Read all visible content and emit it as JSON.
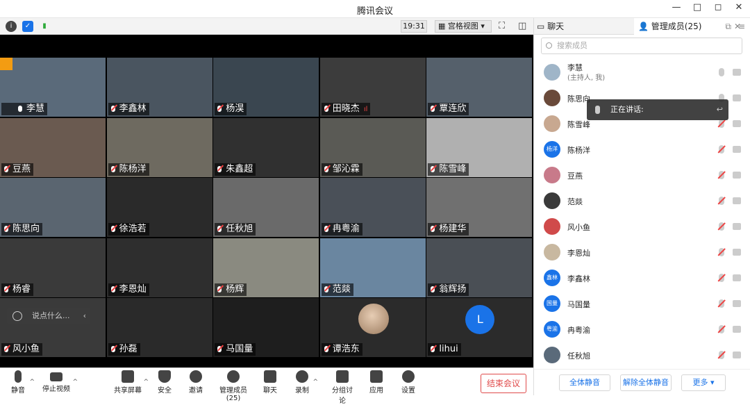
{
  "window": {
    "title": "腾讯会议",
    "controls": [
      "—",
      "□",
      "◻",
      "✕"
    ]
  },
  "toolbar": {
    "time": "19:31",
    "view_label": "宫格视图"
  },
  "tiles": [
    {
      "name": "李慧",
      "host": true,
      "bg": "#5a6a7a"
    },
    {
      "name": "李鑫林",
      "bg": "#4a5560"
    },
    {
      "name": "杨淏",
      "bg": "#3a4650"
    },
    {
      "name": "田晓杰",
      "bg": "#3c3c3c",
      "signal": "ıl"
    },
    {
      "name": "覃连欣",
      "bg": "#55606b"
    },
    {
      "name": "豆燕",
      "bg": "#6a5a50"
    },
    {
      "name": "陈杨洋",
      "bg": "#6e6a60"
    },
    {
      "name": "朱鑫超",
      "bg": "#303030"
    },
    {
      "name": "邹沁霖",
      "bg": "#5a5a55"
    },
    {
      "name": "陈雪峰",
      "bg": "#b0b0b0"
    },
    {
      "name": "陈思向",
      "bg": "#5a6570"
    },
    {
      "name": "徐浩若",
      "bg": "#2a2a2a"
    },
    {
      "name": "任秋旭",
      "bg": "#6a6a6a"
    },
    {
      "name": "冉粤渝",
      "bg": "#4a5058"
    },
    {
      "name": "杨建华",
      "bg": "#707070"
    },
    {
      "name": "杨睿",
      "bg": "#3a3a3a"
    },
    {
      "name": "李恩灿",
      "bg": "#2e2e2e"
    },
    {
      "name": "杨辉",
      "bg": "#8a8a80"
    },
    {
      "name": "范燚",
      "bg": "#6a86a0"
    },
    {
      "name": "翁辉扬",
      "bg": "#4a4f55"
    },
    {
      "name": "风小鱼",
      "bg": "#3a3a3a"
    },
    {
      "name": "孙磊",
      "bg": "#2a2a2a"
    },
    {
      "name": "马国量",
      "bg": "#1e1e1e"
    },
    {
      "name": "谭浩东",
      "bg": "#2b2b2b",
      "avatar": "round"
    },
    {
      "name": "lihui",
      "bg": "#2b2b2b",
      "avatar": "L",
      "avatar_letter": "L"
    }
  ],
  "chat_input": {
    "placeholder": "说点什么..."
  },
  "bottom": {
    "mute": "静音",
    "stop_video": "停止视频",
    "share": "共享屏幕",
    "security": "安全",
    "invite": "邀请",
    "manage": "管理成员(25)",
    "chat": "聊天",
    "record": "录制",
    "breakout": "分组讨论",
    "apps": "应用",
    "settings": "设置",
    "end": "结束会议"
  },
  "panel": {
    "chat_tab": "聊天",
    "members_tab": "管理成员(25)",
    "search_placeholder": "搜索成员",
    "speaking_label": "正在讲话:",
    "mute_all": "全体静音",
    "unmute_all": "解除全体静音",
    "more": "更多"
  },
  "members": [
    {
      "name": "李慧",
      "sub": "(主持人, 我)",
      "mic": "on"
    },
    {
      "name": "陈思向",
      "mic": "on"
    },
    {
      "name": "陈雪峰",
      "mic": "off"
    },
    {
      "name": "陈杨洋",
      "avatar_text": "杨洋",
      "mic": "off"
    },
    {
      "name": "豆燕",
      "mic": "off"
    },
    {
      "name": "范燚",
      "mic": "off"
    },
    {
      "name": "风小鱼",
      "mic": "off"
    },
    {
      "name": "李恩灿",
      "mic": "off"
    },
    {
      "name": "李鑫林",
      "avatar_text": "鑫林",
      "mic": "off"
    },
    {
      "name": "马国量",
      "avatar_text": "国量",
      "mic": "off"
    },
    {
      "name": "冉粤渝",
      "avatar_text": "粤渝",
      "mic": "off"
    },
    {
      "name": "任秋旭",
      "mic": "off"
    }
  ]
}
